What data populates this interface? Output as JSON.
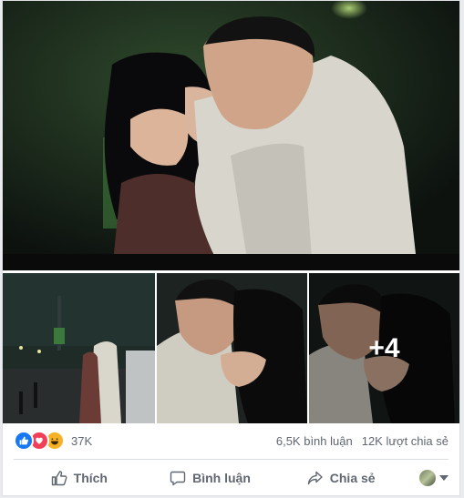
{
  "post": {
    "photos": [
      {
        "description": "main",
        "icon": "photo"
      },
      {
        "description": "thumb",
        "icon": "photo"
      },
      {
        "description": "thumb",
        "icon": "photo"
      },
      {
        "description": "thumb",
        "icon": "photo"
      }
    ],
    "more_photos_label": "+4"
  },
  "reactions": {
    "icons": [
      "like-icon",
      "love-icon",
      "haha-icon"
    ],
    "count": "37K",
    "comments": "6,5K bình luận",
    "shares": "12K lượt chia sẻ"
  },
  "actions": {
    "like_label": "Thích",
    "comment_label": "Bình luận",
    "share_label": "Chia sẻ"
  },
  "colors": {
    "like_blue": "#1877f2",
    "love_red": "#f33e58",
    "haha_yellow": "#f7b125",
    "text_gray": "#606770"
  }
}
